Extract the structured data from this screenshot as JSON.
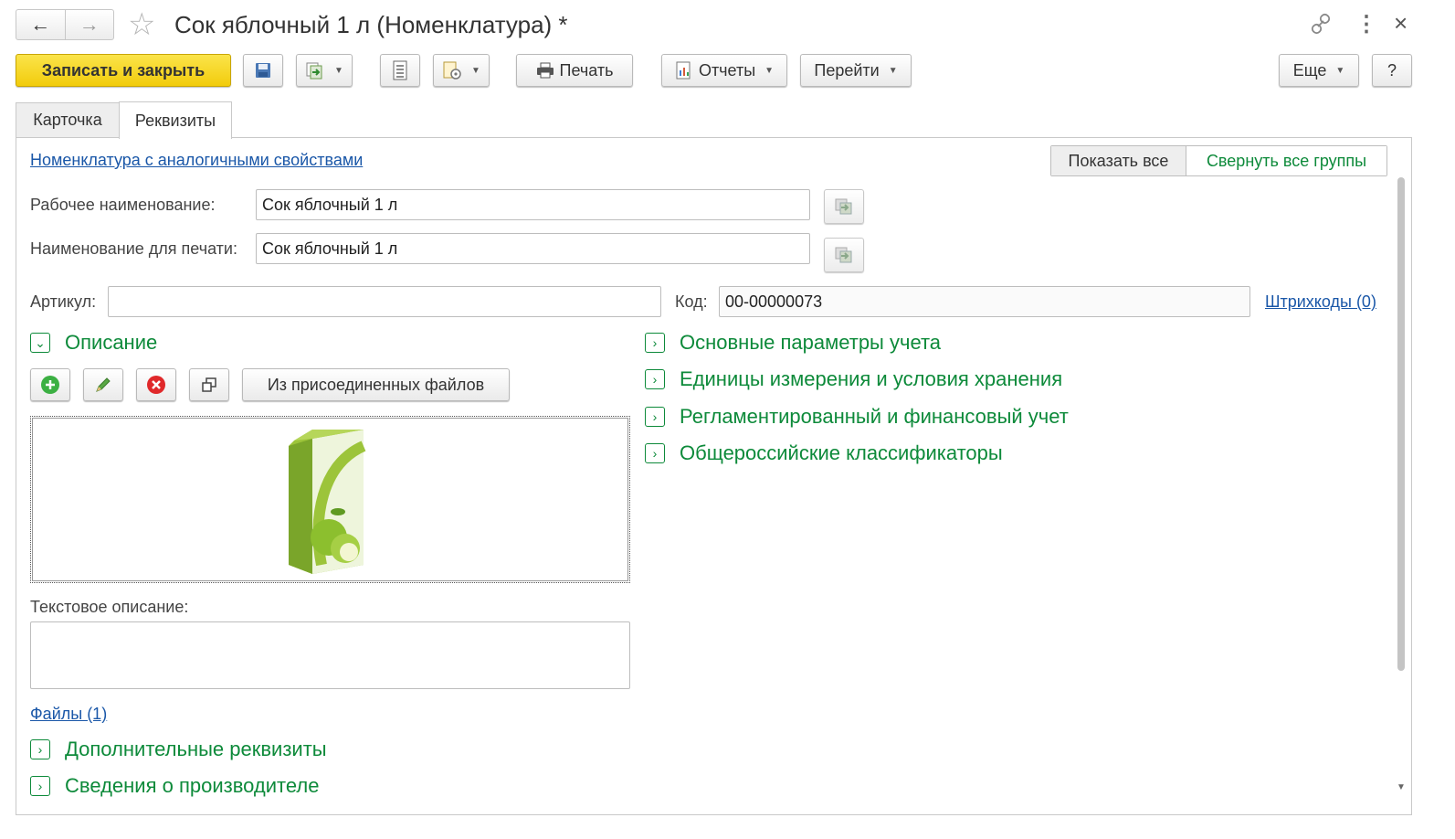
{
  "window": {
    "title": "Сок яблочный 1 л (Номенклатура) *",
    "nav_back": "←",
    "nav_forward": "→",
    "favorite": "☆",
    "link_icon": "🔗",
    "more_icon": "⋮",
    "close_icon": "×"
  },
  "toolbar": {
    "save_close": "Записать и закрыть",
    "print": "Печать",
    "reports": "Отчеты",
    "goto": "Перейти",
    "more": "Еще",
    "help": "?"
  },
  "tabs": [
    {
      "label": "Карточка",
      "active": false
    },
    {
      "label": "Реквизиты",
      "active": true
    }
  ],
  "form": {
    "similar_link": "Номенклатура с аналогичными свойствами",
    "show_all": "Показать все",
    "collapse_all": "Свернуть все группы",
    "work_name_label": "Рабочее наименование:",
    "work_name_value": "Сок яблочный 1 л",
    "print_name_label": "Наименование для печати:",
    "print_name_value": "Сок яблочный 1 л",
    "article_label": "Артикул:",
    "article_value": "",
    "code_label": "Код:",
    "code_value": "00-00000073",
    "barcodes_link": "Штрихкоды (0)"
  },
  "description": {
    "group_label": "Описание",
    "from_files_button": "Из присоединенных файлов",
    "text_description_label": "Текстовое описание:",
    "text_description_value": "",
    "files_link": "Файлы (1)"
  },
  "groups_right": [
    "Основные параметры учета",
    "Единицы измерения и условия хранения",
    "Регламентированный и финансовый учет",
    "Общероссийские классификаторы"
  ],
  "groups_bottom": [
    "Дополнительные реквизиты",
    "Сведения о производителе"
  ],
  "colors": {
    "primary_button": "#f7d81d",
    "group_green": "#0d8a3a",
    "link_blue": "#1a57a8"
  }
}
